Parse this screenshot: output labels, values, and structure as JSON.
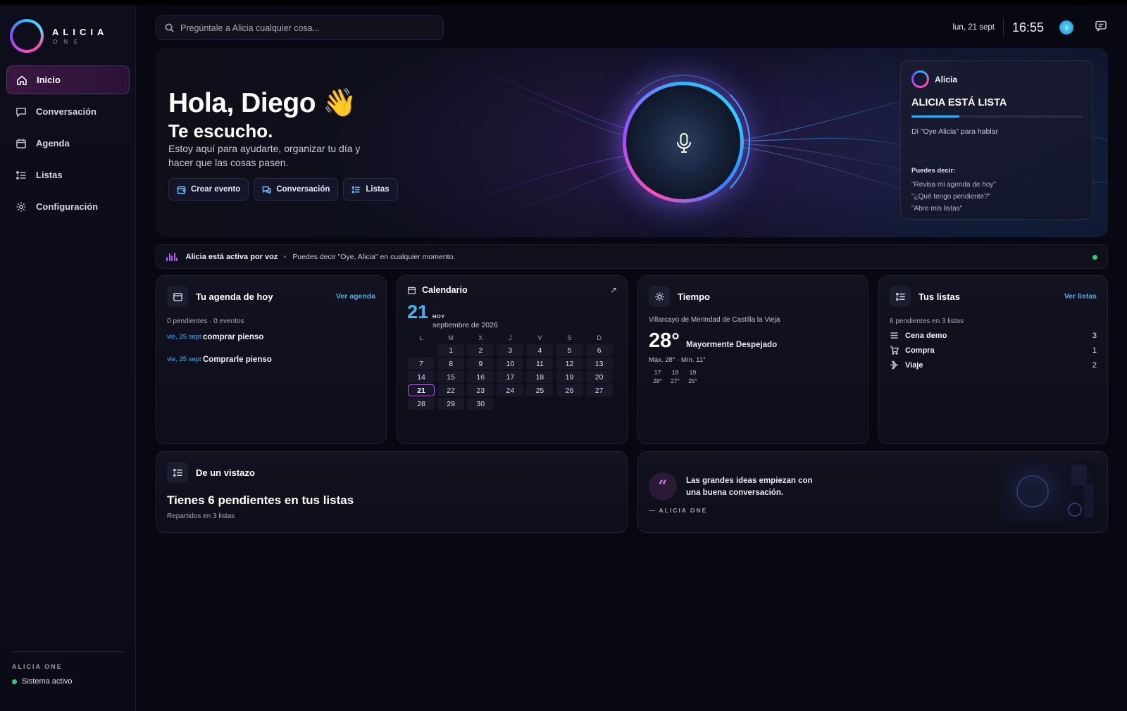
{
  "app": {
    "logo_name": "ALICIA",
    "logo_sub": "ONE"
  },
  "sidebar": {
    "items": [
      {
        "label": "Inicio",
        "icon": "home-icon",
        "active": true
      },
      {
        "label": "Conversación",
        "icon": "chat-icon",
        "active": false
      },
      {
        "label": "Agenda",
        "icon": "calendar-icon",
        "active": false
      },
      {
        "label": "Listas",
        "icon": "list-icon",
        "active": false
      },
      {
        "label": "Configuración",
        "icon": "gear-icon",
        "active": false
      }
    ],
    "footer_title": "ALICIA ONE",
    "status": "Sistema activo"
  },
  "topbar": {
    "search_placeholder": "Pregúntale a Alicia cualquier cosa...",
    "date": "lun, 21 sept",
    "time": "16:55"
  },
  "hero": {
    "greeting": "Hola, Diego 👋",
    "subtitle": "Te escucho.",
    "description": "Estoy aquí para ayudarte, organizar tu día y hacer que las cosas pasen.",
    "buttons": [
      {
        "label": "Crear evento",
        "icon": "calendar-plus-icon"
      },
      {
        "label": "Conversación",
        "icon": "chat-icon"
      },
      {
        "label": "Listas",
        "icon": "list-icon"
      }
    ]
  },
  "assistant_card": {
    "name": "Alicia",
    "title": "ALICIA ESTÁ LISTA",
    "progress": 0.28,
    "hint": "Di \"Oye Alicia\" para hablar",
    "suggestions_title": "Puedes decir:",
    "suggestions": [
      "\"Revisa mi agenda de hoy\"",
      "\"¿Qué tengo pendiente?\"",
      "\"Abre mis listas\""
    ]
  },
  "voicebar": {
    "title": "Alicia está activa por voz",
    "text": "Puedes decir \"Oye, Alicia\" en cualquier momento."
  },
  "agenda": {
    "title": "Tu agenda de hoy",
    "link": "Ver agenda",
    "pending": "0 pendientes",
    "events": "0 eventos",
    "items": [
      {
        "date": "vie, 25 sept",
        "text": "comprar pienso"
      },
      {
        "date": "vie, 25 sept",
        "text": "Comprarle pienso"
      }
    ]
  },
  "calendar": {
    "title": "Calendario",
    "day": "21",
    "today_label": "HOY",
    "month": "septiembre de 2026",
    "weekdays": [
      "L",
      "M",
      "X",
      "J",
      "V",
      "S",
      "D"
    ],
    "weeks": [
      [
        "",
        "1",
        "2",
        "3",
        "4",
        "5",
        "6"
      ],
      [
        "7",
        "8",
        "9",
        "10",
        "11",
        "12",
        "13"
      ],
      [
        "14",
        "15",
        "16",
        "17",
        "18",
        "19",
        "20"
      ],
      [
        "21",
        "22",
        "23",
        "24",
        "25",
        "26",
        "27"
      ],
      [
        "28",
        "29",
        "30",
        "",
        "",
        "",
        ""
      ]
    ],
    "today": "21"
  },
  "weather": {
    "title": "Tiempo",
    "location": "Villarcayo de Merindad de Castilla la Vieja",
    "temp": "28°",
    "condition": "Mayormente Despejado",
    "minmax": "Máx. 28° · Mín. 11°",
    "forecast": [
      {
        "day": "17",
        "temp": "28°"
      },
      {
        "day": "18",
        "temp": "27°"
      },
      {
        "day": "19",
        "temp": "25°"
      }
    ]
  },
  "lists": {
    "title": "Tus listas",
    "link": "Ver listas",
    "summary": "6 pendientes en 3 listas",
    "items": [
      {
        "name": "Cena demo",
        "count": "3",
        "icon": "menu-icon"
      },
      {
        "name": "Compra",
        "count": "1",
        "icon": "cart-icon"
      },
      {
        "name": "Viaje",
        "count": "2",
        "icon": "plane-icon"
      }
    ]
  },
  "overview": {
    "title": "De un vistazo",
    "headline": "Tienes 6 pendientes en tus listas",
    "sub": "Repartidos en 3 listas"
  },
  "quote": {
    "text": "Las grandes ideas empiezan con una buena conversación.",
    "by": "— ALICIA ONE"
  },
  "colors": {
    "accent": "#3fb6f0",
    "brand_purple": "#b25cff",
    "active_nav": "#3a1740",
    "status_green": "#2ecc71"
  }
}
